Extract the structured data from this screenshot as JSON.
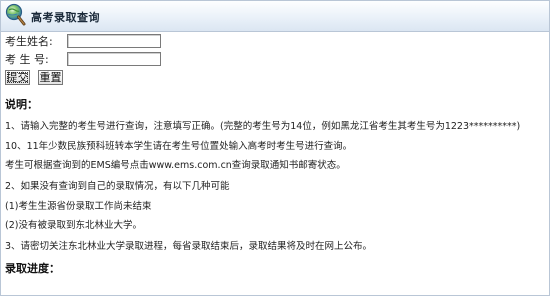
{
  "header": {
    "title": "高考录取查询",
    "logo_icon": "magnifier-globe-icon"
  },
  "form": {
    "name_label": "考生姓名:",
    "name_value": "",
    "number_label": "考 生 号:",
    "number_value": "",
    "submit_label": "提交",
    "reset_label": "重置"
  },
  "notes": {
    "heading": "说明：",
    "line1": "1、请输入完整的考生号进行查询，注意填写正确。(完整的考生号为14位，例如黑龙江省考生其考生号为1223**********)",
    "line2": "10、11年少数民族预科班转本学生请在考生号位置处输入高考时考生号进行查询。",
    "line3": "考生可根据查询到的EMS编号点击www.ems.com.cn查询录取通知书邮寄状态。",
    "line4": "2、如果没有查询到自己的录取情况，有以下几种可能",
    "line5": "(1)考生生源省份录取工作尚未结束",
    "line6": "(2)没有被录取到东北林业大学。",
    "line7": "3、请密切关注东北林业大学录取进程，每省录取结束后，录取结果将及时在网上公布。"
  },
  "progress": {
    "heading": "录取进度："
  },
  "colors": {
    "header_gradient_top": "#fdfeff",
    "header_gradient_bottom": "#dbe6f2",
    "border": "#b9c6d6"
  }
}
